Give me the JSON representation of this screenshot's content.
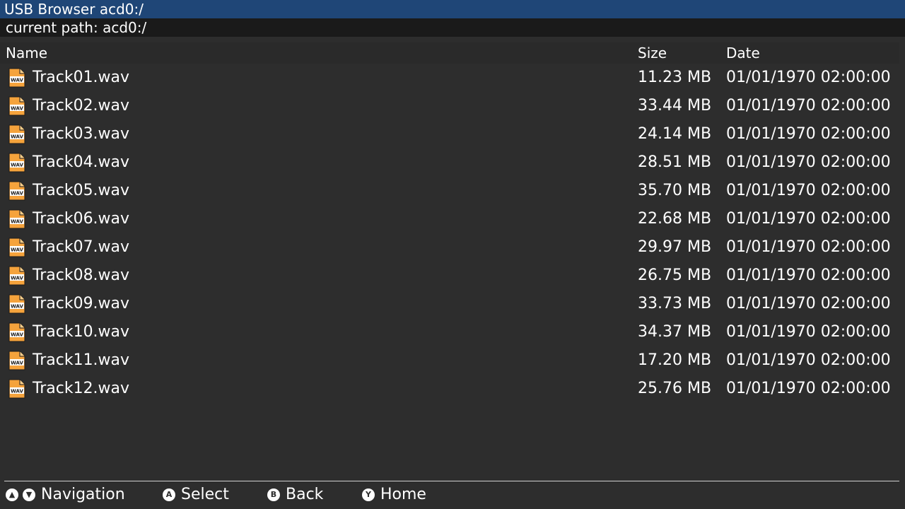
{
  "window": {
    "title": "USB Browser acd0:/",
    "current_path_label": "current path: acd0:/"
  },
  "columns": {
    "name": "Name",
    "size": "Size",
    "date": "Date"
  },
  "files": [
    {
      "name": "Track01.wav",
      "size": "11.23 MB",
      "date": "01/01/1970 02:00:00",
      "icon": "wav-file-icon"
    },
    {
      "name": "Track02.wav",
      "size": "33.44 MB",
      "date": "01/01/1970 02:00:00",
      "icon": "wav-file-icon"
    },
    {
      "name": "Track03.wav",
      "size": "24.14 MB",
      "date": "01/01/1970 02:00:00",
      "icon": "wav-file-icon"
    },
    {
      "name": "Track04.wav",
      "size": "28.51 MB",
      "date": "01/01/1970 02:00:00",
      "icon": "wav-file-icon"
    },
    {
      "name": "Track05.wav",
      "size": "35.70 MB",
      "date": "01/01/1970 02:00:00",
      "icon": "wav-file-icon"
    },
    {
      "name": "Track06.wav",
      "size": "22.68 MB",
      "date": "01/01/1970 02:00:00",
      "icon": "wav-file-icon"
    },
    {
      "name": "Track07.wav",
      "size": "29.97 MB",
      "date": "01/01/1970 02:00:00",
      "icon": "wav-file-icon"
    },
    {
      "name": "Track08.wav",
      "size": "26.75 MB",
      "date": "01/01/1970 02:00:00",
      "icon": "wav-file-icon"
    },
    {
      "name": "Track09.wav",
      "size": "33.73 MB",
      "date": "01/01/1970 02:00:00",
      "icon": "wav-file-icon"
    },
    {
      "name": "Track10.wav",
      "size": "34.37 MB",
      "date": "01/01/1970 02:00:00",
      "icon": "wav-file-icon"
    },
    {
      "name": "Track11.wav",
      "size": "17.20 MB",
      "date": "01/01/1970 02:00:00",
      "icon": "wav-file-icon"
    },
    {
      "name": "Track12.wav",
      "size": "25.76 MB",
      "date": "01/01/1970 02:00:00",
      "icon": "wav-file-icon"
    }
  ],
  "icon_text": "WAV",
  "footer": {
    "navigation": {
      "up_icon": "dpad-up-icon",
      "down_icon": "dpad-down-icon",
      "label": "Navigation"
    },
    "select": {
      "button": "A",
      "label": "Select"
    },
    "back": {
      "button": "B",
      "label": "Back"
    },
    "home": {
      "button": "Y",
      "label": "Home"
    }
  },
  "colors": {
    "titlebar": "#1f4677",
    "background": "#2d2d2d",
    "icon_orange": "#f5a33c"
  }
}
